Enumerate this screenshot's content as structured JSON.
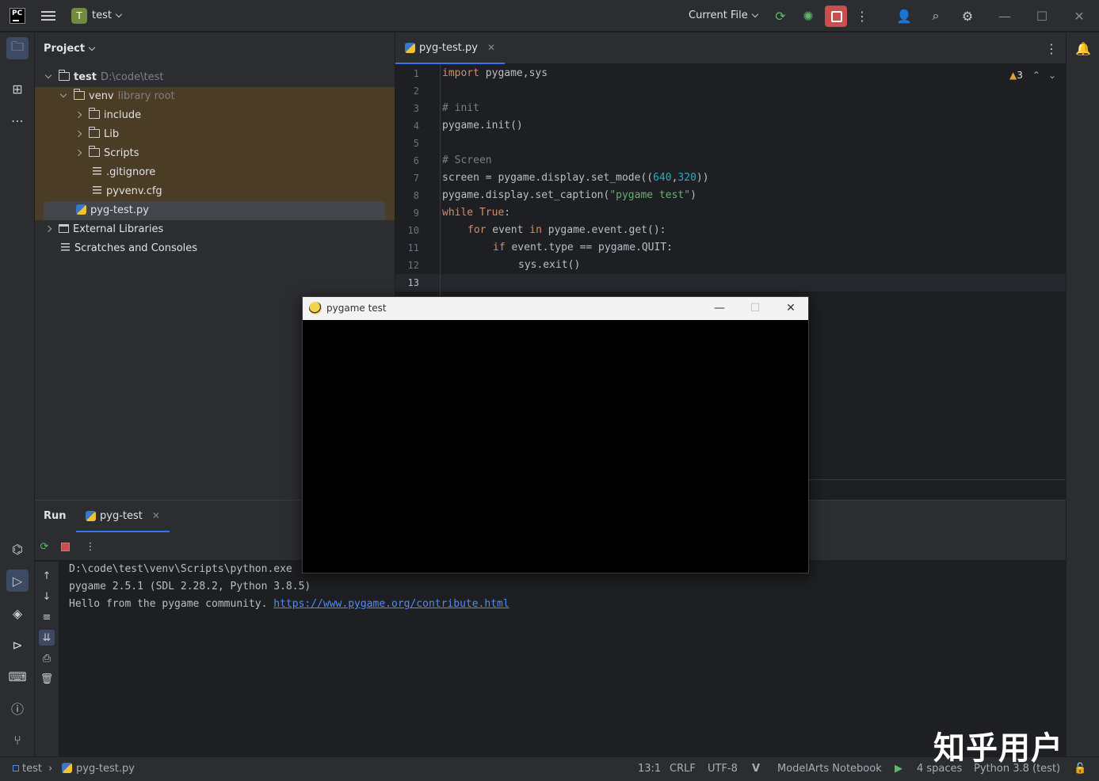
{
  "titlebar": {
    "logo": "PC",
    "project_badge": "T",
    "project_name": "test",
    "run_config": "Current File",
    "icons": [
      "main-menu-icon",
      "rerun-icon",
      "debug-icon",
      "stop-icon",
      "more-icon",
      "add-user-icon",
      "search-icon",
      "settings-icon",
      "minimize-icon",
      "maximize-icon",
      "close-icon"
    ]
  },
  "project": {
    "title": "Project",
    "tree": [
      {
        "label": "test",
        "hint": "D:\\code\\test"
      },
      {
        "label": "venv",
        "hint": "library root"
      },
      {
        "label": "include"
      },
      {
        "label": "Lib"
      },
      {
        "label": "Scripts"
      },
      {
        "label": ".gitignore"
      },
      {
        "label": "pyvenv.cfg"
      },
      {
        "label": "pyg-test.py"
      },
      {
        "label": "External Libraries"
      },
      {
        "label": "Scratches and Consoles"
      }
    ]
  },
  "editor": {
    "tab": "pyg-test.py",
    "warnings": "3",
    "line_numbers": [
      "1",
      "2",
      "3",
      "4",
      "5",
      "6",
      "7",
      "8",
      "9",
      "10",
      "11",
      "12",
      "13"
    ],
    "code": {
      "l1_kw": "import",
      "l1_rest": " pygame,sys",
      "l3": "# init",
      "l4": "pygame.init()",
      "l6": "# Screen",
      "l7_a": "screen = pygame.display.set_mode((",
      "l7_n1": "640",
      "l7_c": ",",
      "l7_n2": "320",
      "l7_b": "))",
      "l8_a": "pygame.display.set_caption(",
      "l8_s": "\"pygame test\"",
      "l8_b": ")",
      "l9_kw": "while",
      "l9_kw2": " True",
      "l9_b": ":",
      "l10_kw": "for",
      "l10_a": " event ",
      "l10_kw2": "in",
      "l10_b": " pygame.event.get():",
      "l11_kw": "if",
      "l11_a": " event.type == pygame.QUIT:",
      "l12": "sys.exit()"
    }
  },
  "run": {
    "label": "Run",
    "tab": "pyg-test",
    "output": [
      "D:\\code\\test\\venv\\Scripts\\python.exe",
      "pygame 2.5.1 (SDL 2.28.2, Python 3.8.5)",
      "Hello from the pygame community. "
    ],
    "link": "https://www.pygame.org/contribute.html"
  },
  "pygame_window": {
    "title": "pygame test"
  },
  "statusbar": {
    "crumb_project": "test",
    "crumb_file": "pyg-test.py",
    "position": "13:1",
    "line_sep": "CRLF",
    "encoding": "UTF-8",
    "notebook": "ModelArts Notebook",
    "indent": "4 spaces",
    "interpreter": "Python 3.8 (test)"
  },
  "watermark": "知乎用户",
  "colors": {
    "accent": "#3574f0",
    "stop": "#c94f4f",
    "selection": "#4b3c25"
  }
}
